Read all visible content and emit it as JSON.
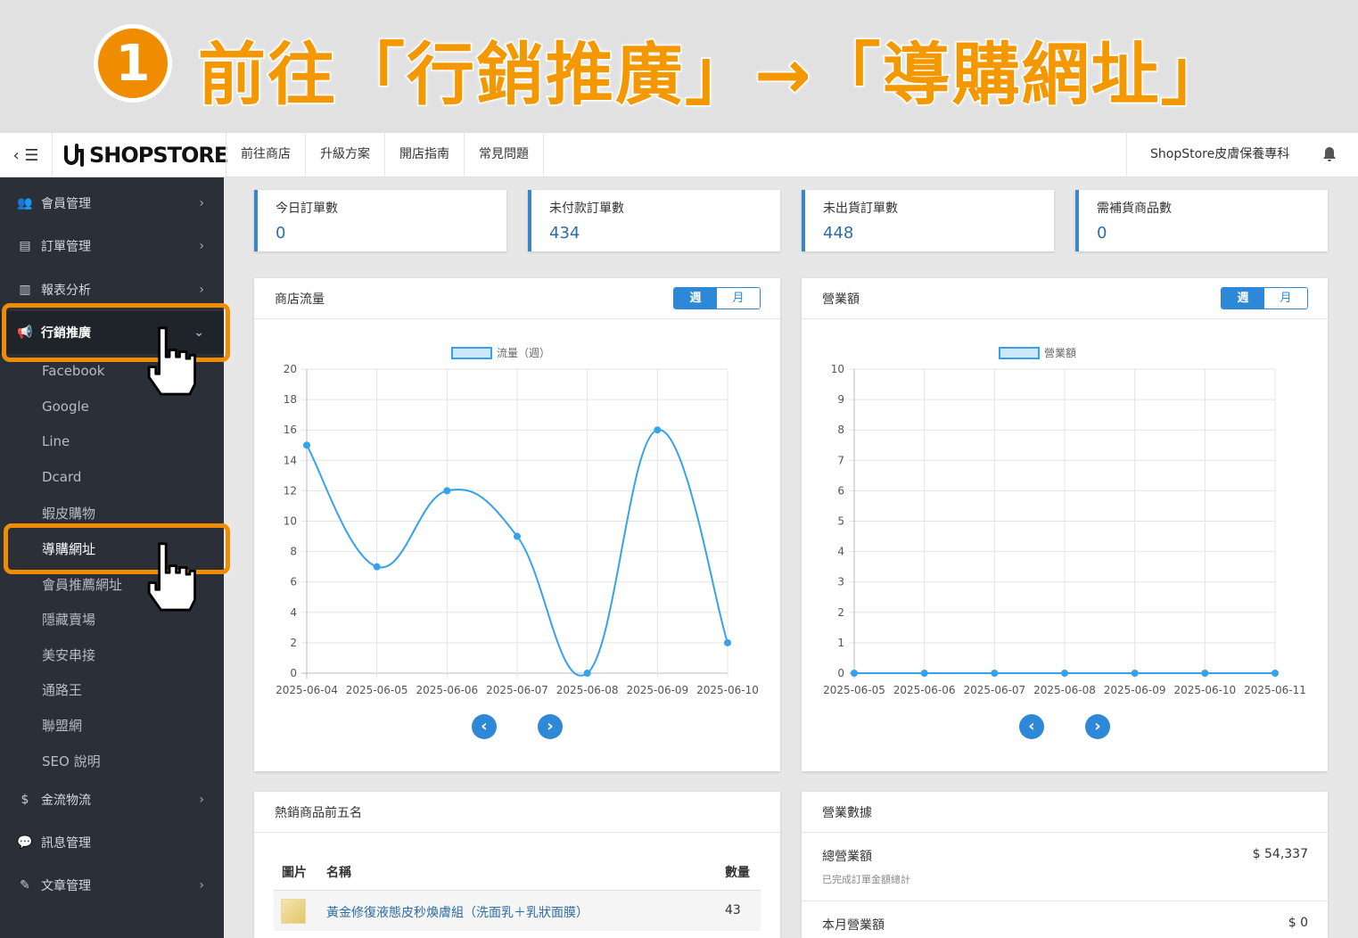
{
  "banner": {
    "step_number": "1",
    "title": "前往「行銷推廣」→「導購網址」"
  },
  "header": {
    "logo_text": "SHOPSTORE",
    "nav": [
      "前往商店",
      "升級方案",
      "開店指南",
      "常見問題"
    ],
    "store_name": "ShopStore皮膚保養專科"
  },
  "sidebar": {
    "items": [
      {
        "label": "會員管理",
        "icon": "users-icon"
      },
      {
        "label": "訂單管理",
        "icon": "copy-icon"
      },
      {
        "label": "報表分析",
        "icon": "bar-chart-icon"
      },
      {
        "label": "行銷推廣",
        "icon": "bullhorn-icon"
      },
      {
        "label": "金流物流",
        "icon": "dollar-icon"
      },
      {
        "label": "訊息管理",
        "icon": "comments-icon"
      },
      {
        "label": "文章管理",
        "icon": "edit-icon"
      }
    ],
    "marketing_sub": [
      "Facebook",
      "Google",
      "Line",
      "Dcard",
      "蝦皮購物",
      "導購網址",
      "會員推薦網址",
      "隱藏賣場",
      "美安串接",
      "通路王",
      "聯盟網",
      "SEO 說明"
    ]
  },
  "stats": [
    {
      "label": "今日訂單數",
      "value": "0"
    },
    {
      "label": "未付款訂單數",
      "value": "434"
    },
    {
      "label": "未出貨訂單數",
      "value": "448"
    },
    {
      "label": "需補貨商品數",
      "value": "0"
    }
  ],
  "traffic_panel": {
    "title": "商店流量",
    "week": "週",
    "month": "月"
  },
  "revenue_panel": {
    "title": "營業額",
    "week": "週",
    "month": "月"
  },
  "chart_data": [
    {
      "type": "line",
      "title": "",
      "series": [
        {
          "name": "流量（週）",
          "values": [
            15,
            7,
            12,
            9,
            0,
            16,
            2
          ]
        }
      ],
      "x": [
        "2025-06-04",
        "2025-06-05",
        "2025-06-06",
        "2025-06-07",
        "2025-06-08",
        "2025-06-09",
        "2025-06-10"
      ],
      "ylim": [
        0,
        20
      ],
      "yticks": [
        0,
        2,
        4,
        6,
        8,
        10,
        12,
        14,
        16,
        18,
        20
      ],
      "grid": true,
      "legend": "top-center",
      "color": "#36a2eb"
    },
    {
      "type": "line",
      "title": "",
      "series": [
        {
          "name": "營業額",
          "values": [
            0,
            0,
            0,
            0,
            0,
            0,
            0
          ]
        }
      ],
      "x": [
        "2025-06-05",
        "2025-06-06",
        "2025-06-07",
        "2025-06-08",
        "2025-06-09",
        "2025-06-10",
        "2025-06-11"
      ],
      "ylim": [
        0,
        10
      ],
      "yticks": [
        0,
        1,
        2,
        3,
        4,
        5,
        6,
        7,
        8,
        9,
        10
      ],
      "grid": true,
      "legend": "top-center",
      "color": "#36a2eb"
    }
  ],
  "top_products": {
    "title": "熱銷商品前五名",
    "columns": [
      "圖片",
      "名稱",
      "數量"
    ],
    "rows": [
      {
        "name": "黃金修復液態皮秒煥膚組（洗面乳＋乳狀面膜）",
        "qty": "43"
      }
    ]
  },
  "revenue_data": {
    "title": "營業數據",
    "total_label": "總營業額",
    "total_sub": "已完成訂單金額總計",
    "total_value": "$ 54,337",
    "month_label": "本月營業額",
    "month_value": "$ 0"
  },
  "colors": {
    "accent": "#2e88d8",
    "highlight": "#f08c00",
    "sidebar": "#2a2f38"
  }
}
